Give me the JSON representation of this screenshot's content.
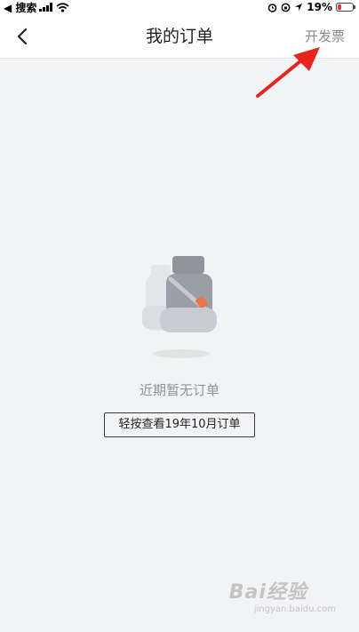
{
  "status_bar": {
    "back_app": "◀ 搜索",
    "battery_percent": "19%",
    "battery_color": "#e53935"
  },
  "nav": {
    "title": "我的订单",
    "invoice_label": "开发票",
    "back_icon": "chevron-left-icon"
  },
  "empty_state": {
    "message": "近期暂无订单",
    "history_button_label": "轻按查看19年10月订单",
    "illustration": "car-seat-illustration"
  },
  "annotation": {
    "arrow_color": "#e8231b"
  },
  "watermark": {
    "brand": "Bai经验",
    "url": "jingyan.baidu.com"
  }
}
